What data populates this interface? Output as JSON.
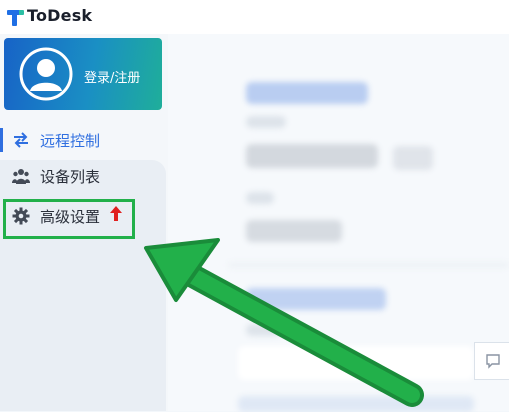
{
  "app": {
    "title": "ToDesk"
  },
  "account": {
    "login_label": "登录/注册"
  },
  "sidebar": {
    "items": [
      {
        "label": "远程控制",
        "icon": "swap-arrows-icon",
        "active": true
      },
      {
        "label": "设备列表",
        "icon": "users-icon",
        "active": false
      },
      {
        "label": "高级设置",
        "icon": "gear-icon",
        "active": false,
        "badge_icon": "red-up-arrow-icon"
      }
    ]
  },
  "colors": {
    "accent": "#2f6fe0",
    "highlight": "#22b04a",
    "annotation_arrow": "#22b04a",
    "badge": "#e02020"
  }
}
